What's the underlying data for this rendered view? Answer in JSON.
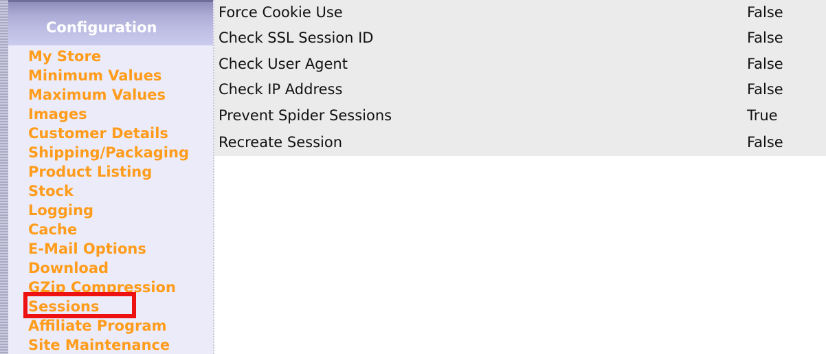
{
  "sidebar": {
    "title": "Configuration",
    "items": [
      {
        "label": "My Store"
      },
      {
        "label": "Minimum Values"
      },
      {
        "label": "Maximum Values"
      },
      {
        "label": "Images"
      },
      {
        "label": "Customer Details"
      },
      {
        "label": "Shipping/Packaging"
      },
      {
        "label": "Product Listing"
      },
      {
        "label": "Stock"
      },
      {
        "label": "Logging"
      },
      {
        "label": "Cache"
      },
      {
        "label": "E-Mail Options"
      },
      {
        "label": "Download"
      },
      {
        "label": "GZip Compression"
      },
      {
        "label": "Sessions",
        "highlighted": true
      },
      {
        "label": "Affiliate Program"
      },
      {
        "label": "Site Maintenance"
      }
    ]
  },
  "settings": {
    "rows": [
      {
        "title": "Force Cookie Use",
        "value": "False"
      },
      {
        "title": "Check SSL Session ID",
        "value": "False"
      },
      {
        "title": "Check User Agent",
        "value": "False"
      },
      {
        "title": "Check IP Address",
        "value": "False"
      },
      {
        "title": "Prevent Spider Sessions",
        "value": "True"
      },
      {
        "title": "Recreate Session",
        "value": "False"
      }
    ]
  },
  "colors": {
    "link_orange": "#ff9c1b",
    "sidebar_background": "#ebebf9",
    "table_background": "#ebebeb",
    "highlight_red": "#ee1111"
  }
}
